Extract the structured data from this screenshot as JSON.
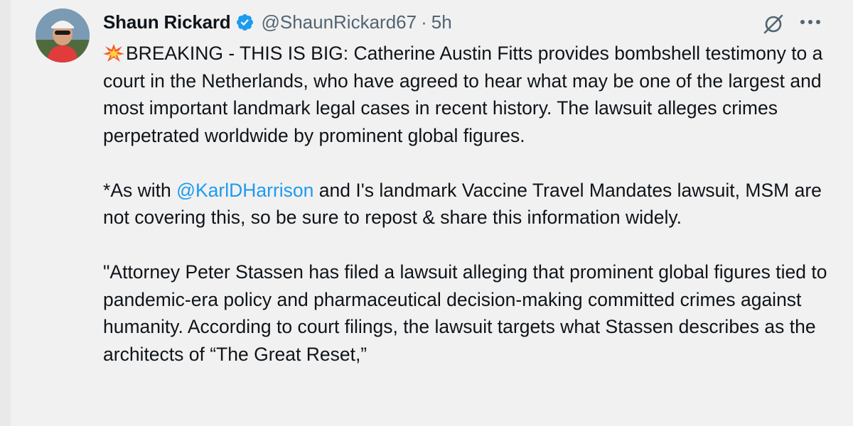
{
  "tweet": {
    "author_name": "Shaun Rickard",
    "handle": "@ShaunRickard67",
    "separator": "·",
    "time": "5h",
    "icons": {
      "verified": "verified-badge-icon",
      "grok": "grok-icon",
      "more": "more-options-icon",
      "spark": "collision-emoji-icon"
    },
    "colors": {
      "accent": "#1d9bf0",
      "text": "#0f1419",
      "muted": "#536471"
    },
    "p1": "BREAKING - THIS IS BIG: Catherine Austin Fitts provides bombshell testimony to a court in the Netherlands, who have agreed to hear what may be one of the largest and most important landmark legal cases in recent history. The lawsuit alleges crimes perpetrated worldwide by prominent global figures.",
    "p2_before": "*As with ",
    "p2_mention": "@KarlDHarrison",
    "p2_after": " and I's landmark Vaccine Travel Mandates lawsuit, MSM are not covering this, so be sure to repost & share this information widely.",
    "p3": "\"Attorney Peter Stassen has filed a lawsuit alleging that prominent global figures tied to pandemic-era policy and pharmaceutical decision-making committed crimes against humanity. According to court filings, the lawsuit targets what Stassen describes as the architects of “The Great Reset,”"
  }
}
